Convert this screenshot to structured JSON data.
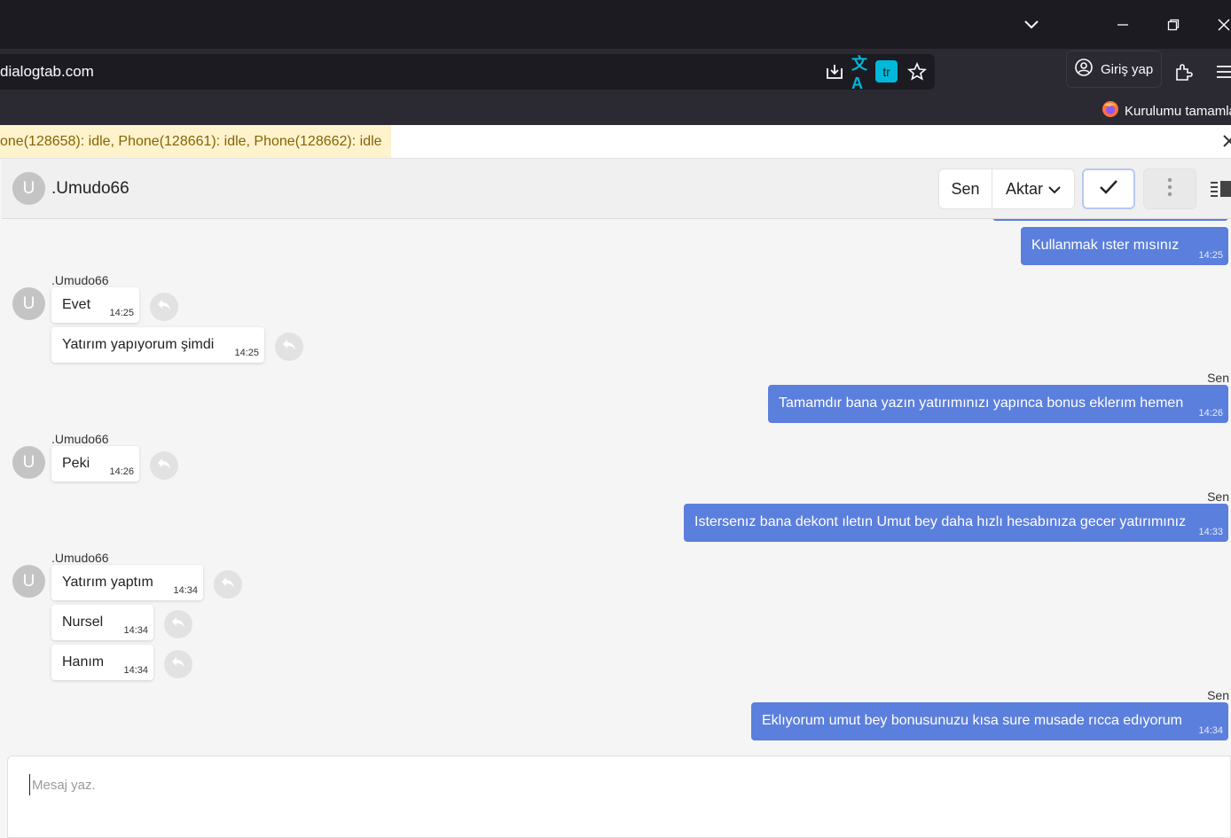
{
  "browser": {
    "url": "dialogtab.com",
    "translate_badge": "tr",
    "login_label": "Giriş yap",
    "bookmark_label": "Kurulumu tamamla"
  },
  "notice": {
    "text": "one(128658): idle, Phone(128661): idle, Phone(128662): idle"
  },
  "chat": {
    "contact_initial": "U",
    "contact_name": ".Umudo66",
    "sen_button": "Sen",
    "aktar_button": "Aktar"
  },
  "messages": [
    {
      "dir": "out",
      "text": "Kullanmak ıster mısınız",
      "time": "14:25"
    },
    {
      "dir": "in",
      "sender": ".Umudo66",
      "initial": "U",
      "text": "Evet",
      "time": "14:25"
    },
    {
      "dir": "in",
      "text": "Yatırım yapıyorum şimdi",
      "time": "14:25"
    },
    {
      "dir": "out",
      "label": "Sen",
      "text": "Tamamdır bana yazın yatırımınızı yapınca bonus eklerım hemen",
      "time": "14:26"
    },
    {
      "dir": "in",
      "sender": ".Umudo66",
      "initial": "U",
      "text": "Peki",
      "time": "14:26"
    },
    {
      "dir": "out",
      "label": "Sen",
      "text": "Istersenız bana dekont ıletın Umut bey daha hızlı hesabınıza gecer yatırımınız",
      "time": "14:33"
    },
    {
      "dir": "in",
      "sender": ".Umudo66",
      "initial": "U",
      "text": "Yatırım yaptım",
      "time": "14:34"
    },
    {
      "dir": "in",
      "text": "Nursel",
      "time": "14:34"
    },
    {
      "dir": "in",
      "text": "Hanım",
      "time": "14:34"
    },
    {
      "dir": "out",
      "label": "Sen",
      "text": "Eklıyorum umut bey bonusunuzu kısa sure musade rıcca edıyorum",
      "time": "14:34"
    }
  ],
  "compose": {
    "placeholder": "Mesaj yaz."
  },
  "icons": {
    "dropdown": "chevron-down-icon",
    "minimize": "minimize-icon",
    "restore": "restore-icon",
    "close": "close-icon",
    "download": "download-icon",
    "translate": "translate-icon",
    "star": "star-icon",
    "account": "account-icon",
    "extensions": "extensions-icon",
    "menu": "menu-icon",
    "firefox": "firefox-icon",
    "reply": "reply-icon",
    "check": "check-icon",
    "more": "more-vertical-icon",
    "panel": "panel-toggle-icon"
  },
  "colors": {
    "outgoing_bubble": "#5b7fdc",
    "notice_bg": "#fff3cd",
    "notice_text": "#856404"
  }
}
